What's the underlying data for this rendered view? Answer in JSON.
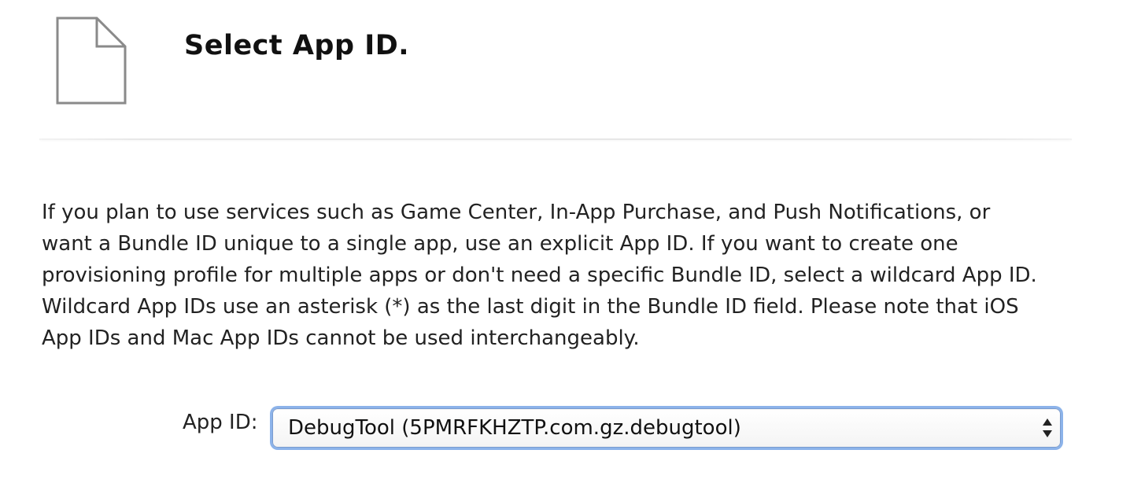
{
  "header": {
    "icon": "document-icon",
    "title": "Select App ID."
  },
  "description": "If you plan to use services such as Game Center, In-App Purchase, and Push Notifications, or want a Bundle ID unique to a single app, use an explicit App ID. If you want to create one provisioning profile for multiple apps or don't need a specific Bundle ID, select a wildcard App ID. Wildcard App IDs use an asterisk (*) as the last digit in the Bundle ID field. Please note that iOS App IDs and Mac App IDs cannot be used interchangeably.",
  "form": {
    "app_id_label": "App ID:",
    "app_id_selected": "DebugTool (5PMRFKHZTP.com.gz.debugtool)",
    "arrows_icon": "up-down-arrows-icon"
  },
  "colors": {
    "focus_ring": "#8cb3ea",
    "icon_stroke": "#8a8a8a"
  }
}
